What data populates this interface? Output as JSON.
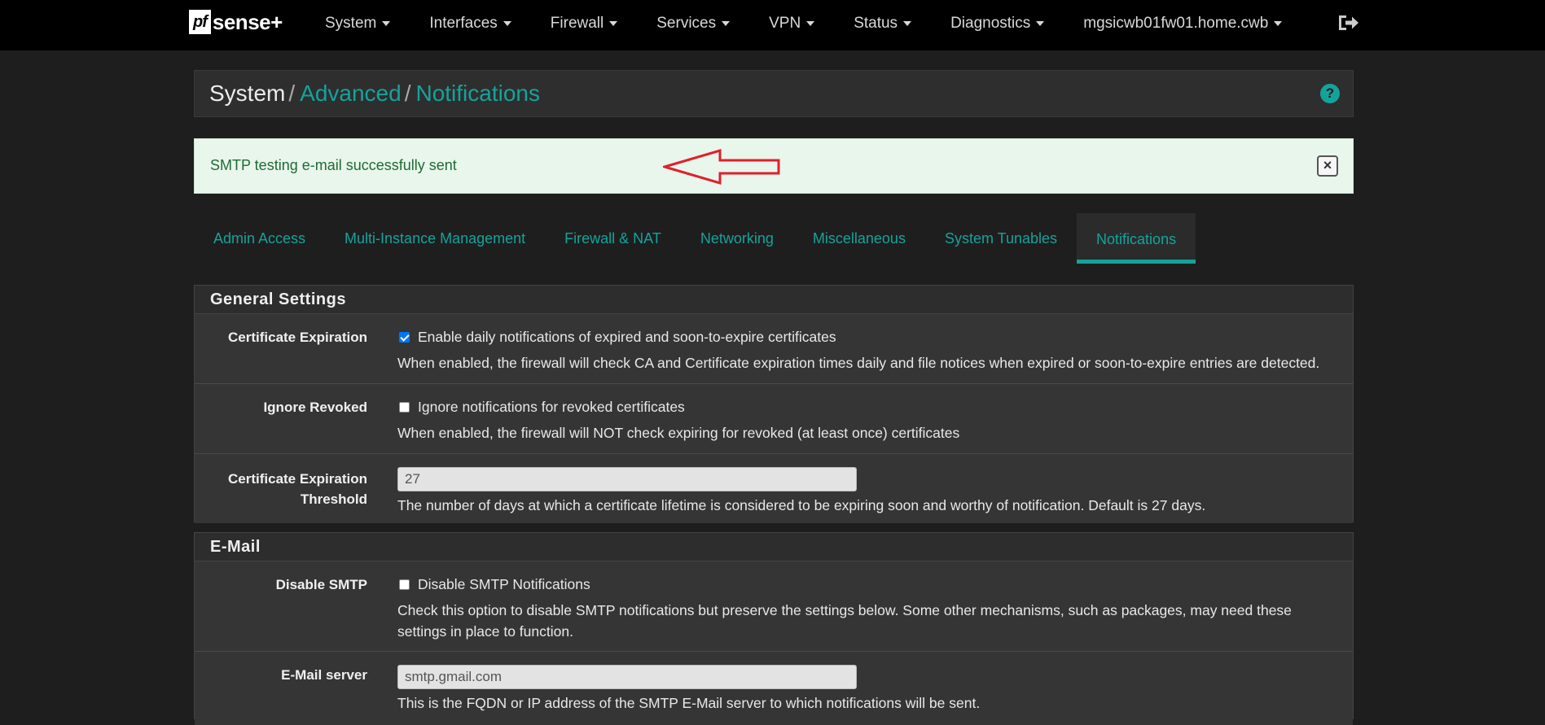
{
  "navbar": {
    "brand_pf": "pf",
    "brand_rest": "sense",
    "brand_plus": "+",
    "menu": [
      "System",
      "Interfaces",
      "Firewall",
      "Services",
      "VPN",
      "Status",
      "Diagnostics",
      "mgsicwb01fw01.home.cwb"
    ]
  },
  "breadcrumb": {
    "root": "System",
    "sep1": "/",
    "level2": "Advanced",
    "sep2": "/",
    "level3": "Notifications"
  },
  "alert": {
    "message": "SMTP testing e-mail successfully sent",
    "close_glyph": "×",
    "arrow_color": "#e0202a"
  },
  "tabs": [
    "Admin Access",
    "Multi-Instance Management",
    "Firewall & NAT",
    "Networking",
    "Miscellaneous",
    "System Tunables",
    "Notifications"
  ],
  "active_tab": "Notifications",
  "general": {
    "title": "General Settings",
    "cert_exp": {
      "label": "Certificate Expiration",
      "checkbox_label": "Enable daily notifications of expired and soon-to-expire certificates",
      "checked": true,
      "help": "When enabled, the firewall will check CA and Certificate expiration times daily and file notices when expired or soon-to-expire entries are detected."
    },
    "ignore_revoked": {
      "label": "Ignore Revoked",
      "checkbox_label": "Ignore notifications for revoked certificates",
      "checked": false,
      "help": "When enabled, the firewall will NOT check expiring for revoked (at least once) certificates"
    },
    "threshold": {
      "label_line1": "Certificate Expiration",
      "label_line2": "Threshold",
      "value": "27",
      "help": "The number of days at which a certificate lifetime is considered to be expiring soon and worthy of notification. Default is 27 days."
    }
  },
  "email": {
    "title": "E-Mail",
    "disable_smtp": {
      "label": "Disable SMTP",
      "checkbox_label": "Disable SMTP Notifications",
      "checked": false,
      "help": "Check this option to disable SMTP notifications but preserve the settings below. Some other mechanisms, such as packages, may need these settings in place to function."
    },
    "server": {
      "label": "E-Mail server",
      "value": "smtp.gmail.com",
      "help": "This is the FQDN or IP address of the SMTP E-Mail server to which notifications will be sent."
    }
  },
  "colors": {
    "accent": "#14a39b",
    "background": "#1e1e1e",
    "alert_bg": "#e8f6ec",
    "alert_text": "#1f6b33"
  }
}
